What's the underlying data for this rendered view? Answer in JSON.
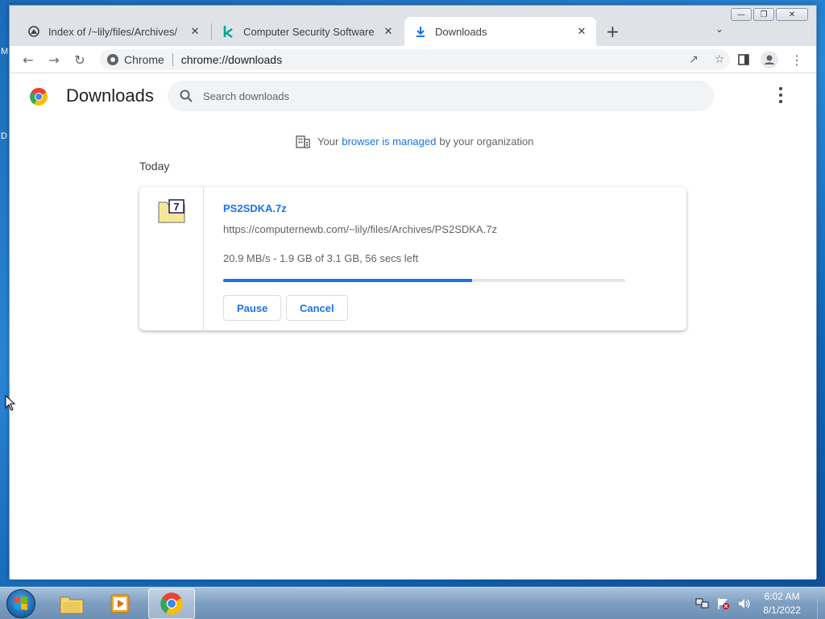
{
  "desktop": {
    "edge_letter_1": "M",
    "edge_letter_2": "D"
  },
  "tabs": [
    {
      "title": "Index of /~lily/files/Archives/",
      "icon": "archive-icon"
    },
    {
      "title": "Computer Security Software for Home",
      "icon": "kaspersky-k-icon"
    },
    {
      "title": "Downloads",
      "icon": "download-arrow-icon",
      "active": true
    }
  ],
  "toolbar": {
    "site_chip": "Chrome",
    "url": "chrome://downloads"
  },
  "page": {
    "title": "Downloads",
    "search_placeholder": "Search downloads",
    "managed": {
      "prefix": "Your",
      "link": "browser is managed",
      "suffix": "by your organization"
    },
    "section": "Today"
  },
  "download": {
    "file_name": "PS2SDKA.7z",
    "url": "https://computernewb.com/~lily/files/Archives/PS2SDKA.7z",
    "status": "20.9 MB/s - 1.9 GB of 3.1 GB, 56 secs left",
    "progress_fraction": 0.62,
    "pause_label": "Pause",
    "cancel_label": "Cancel"
  },
  "taskbar": {
    "time": "6:02 AM",
    "date": "8/1/2022"
  },
  "colors": {
    "accent": "#1a73e8",
    "muted": "#5f6368"
  }
}
